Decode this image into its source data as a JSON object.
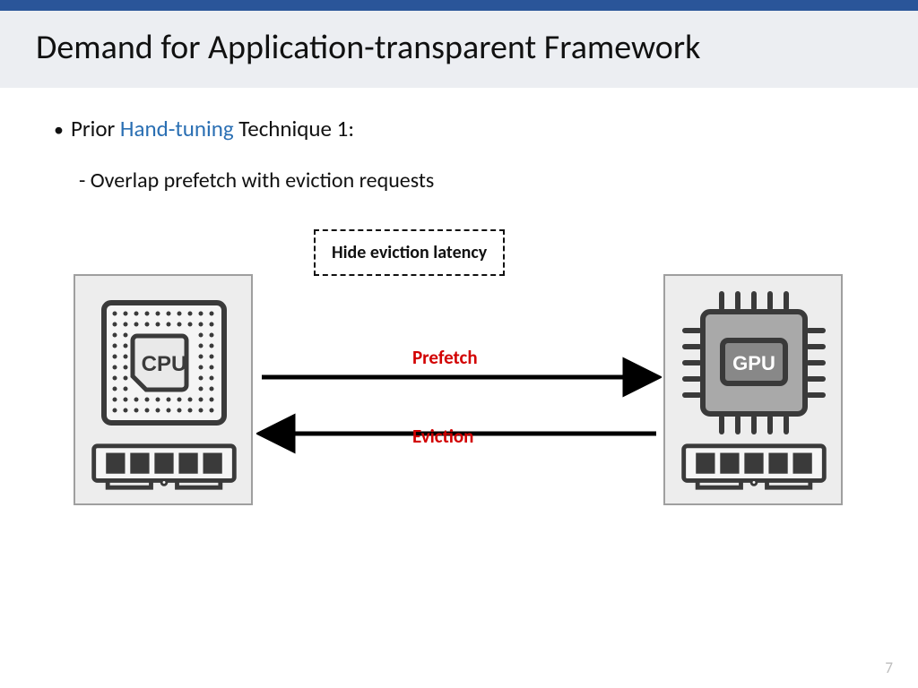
{
  "title": "Demand for Application-transparent Framework",
  "bullet": {
    "prefix": "Prior ",
    "highlight": "Hand-tuning",
    "suffix": " Technique 1:"
  },
  "subline": "- Overlap prefetch with eviction requests",
  "callout": "Hide eviction latency",
  "arrows": {
    "prefetch": "Prefetch",
    "eviction": "Eviction"
  },
  "chips": {
    "cpu_label": "CPU",
    "gpu_label": "GPU"
  },
  "page_number": "7"
}
